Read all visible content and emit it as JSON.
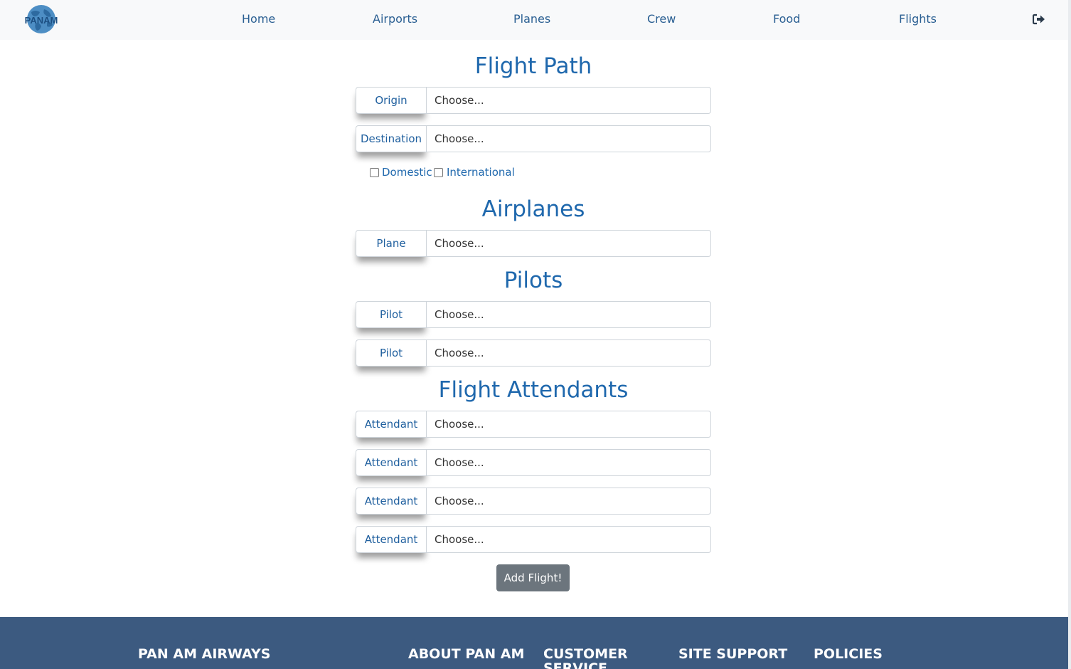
{
  "brand": {
    "logo_text": "PANAM"
  },
  "nav": {
    "items": [
      "Home",
      "Airports",
      "Planes",
      "Crew",
      "Food",
      "Flights"
    ],
    "logout_icon": "sign-out-icon"
  },
  "sections": {
    "flight_path": {
      "title": "Flight Path",
      "fields": [
        {
          "label": "Origin",
          "value": "Choose..."
        },
        {
          "label": "Destination",
          "value": "Choose..."
        }
      ],
      "checkboxes": [
        {
          "label": "Domestic",
          "checked": false
        },
        {
          "label": "International",
          "checked": false
        }
      ]
    },
    "airplanes": {
      "title": "Airplanes",
      "fields": [
        {
          "label": "Plane",
          "value": "Choose..."
        }
      ]
    },
    "pilots": {
      "title": "Pilots",
      "fields": [
        {
          "label": "Pilot",
          "value": "Choose..."
        },
        {
          "label": "Pilot",
          "value": "Choose..."
        }
      ]
    },
    "attendants": {
      "title": "Flight Attendants",
      "fields": [
        {
          "label": "Attendant",
          "value": "Choose..."
        },
        {
          "label": "Attendant",
          "value": "Choose..."
        },
        {
          "label": "Attendant",
          "value": "Choose..."
        },
        {
          "label": "Attendant",
          "value": "Choose..."
        }
      ]
    }
  },
  "submit_label": "Add Flight!",
  "footer": {
    "headings": [
      "PAN AM AIRWAYS",
      "ABOUT PAN AM",
      "CUSTOMER SERVICE",
      "SITE SUPPORT",
      "POLICIES"
    ]
  },
  "colors": {
    "accent": "#1f68ad",
    "navbar_bg": "#f8f9fa",
    "button_bg": "#6c757d",
    "footer_bg": "#3c5a80"
  }
}
